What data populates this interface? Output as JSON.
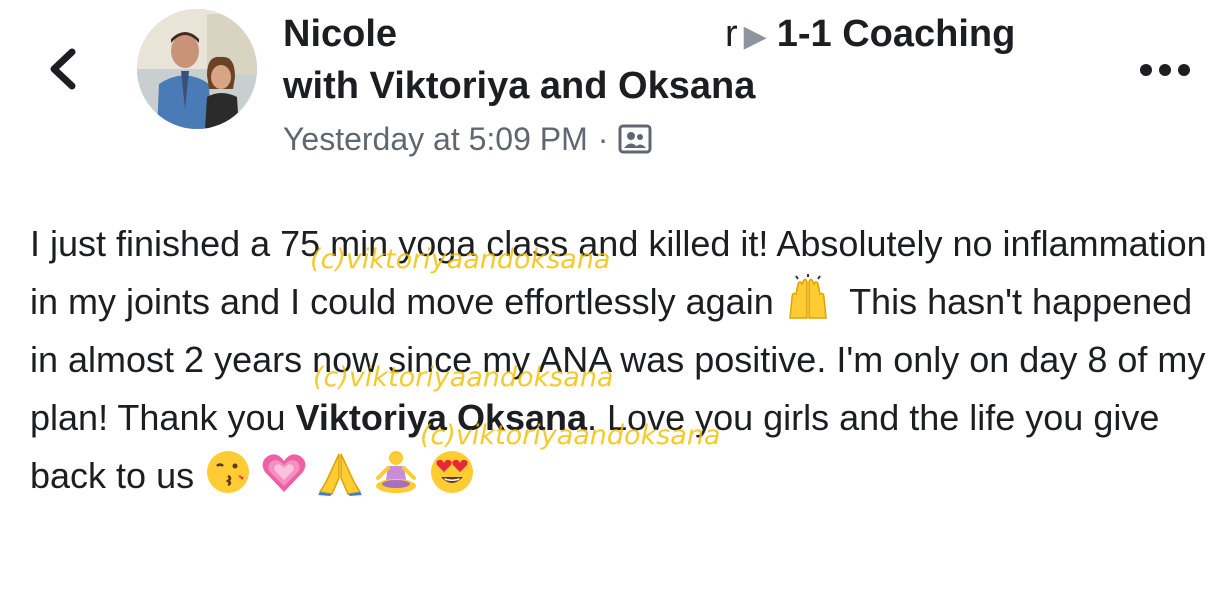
{
  "header": {
    "author": "Nicole",
    "group_trail_fragment": "r",
    "group_name": "1-1 Coaching",
    "tagged_line": "with Viktoriya and Oksana",
    "timestamp": "Yesterday at 5:09 PM",
    "separator": "·",
    "audience_icon": "group-audience-icon",
    "back_icon": "chevron-left-icon",
    "more_icon": "more-options-icon",
    "arrow_icon": "triangle-right-icon"
  },
  "post": {
    "seg1": "I just finished a 75 min yoga class and killed it! Absolutely no inflammation in my joints and I could move effortlessly again ",
    "seg2": " This hasn't happened in almost 2 years now since my ANA was positive. I'm only on day 8 of my plan! Thank you ",
    "mention": "Viktoriya Oksana",
    "seg3": ". Love you girls and the life you give back to us ",
    "emojis": [
      "raising-hands-emoji",
      "kissing-face-emoji",
      "growing-heart-emoji",
      "folded-hands-emoji",
      "lotus-position-emoji",
      "heart-eyes-emoji"
    ]
  },
  "watermark": {
    "text": "(c)viktoriyaandoksana"
  },
  "colors": {
    "text": "#1c1e21",
    "secondary": "#616770",
    "arrow": "#8d949e",
    "watermark": "#f2be00"
  }
}
